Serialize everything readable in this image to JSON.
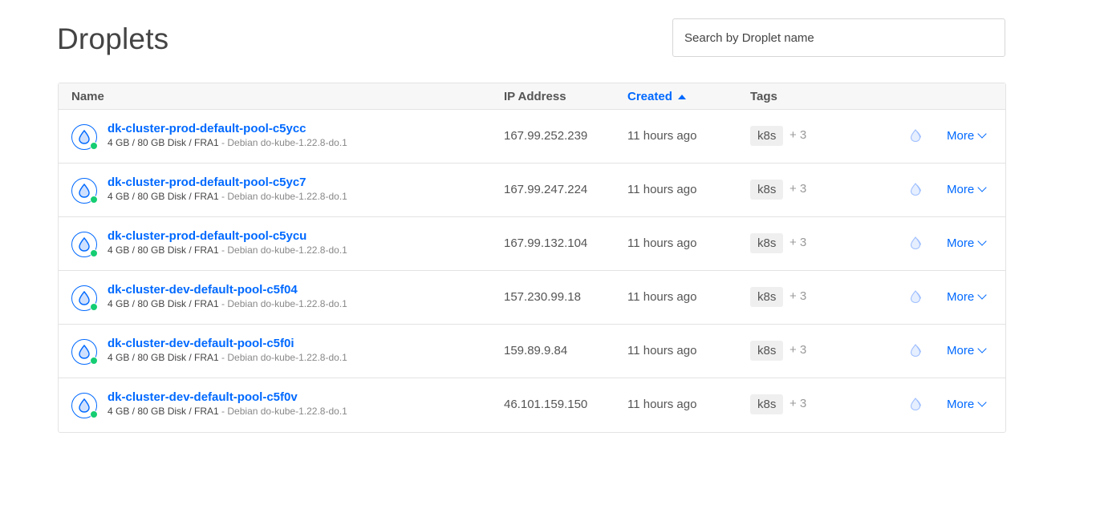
{
  "page": {
    "title": "Droplets"
  },
  "search": {
    "placeholder": "Search by Droplet name"
  },
  "table": {
    "headers": {
      "name": "Name",
      "ip": "IP Address",
      "created": "Created",
      "tags": "Tags"
    },
    "rows": [
      {
        "name": "dk-cluster-prod-default-pool-c5ycc",
        "specs": "4 GB / 80 GB Disk / FRA1",
        "image": " - Debian do-kube-1.22.8-do.1",
        "ip": "167.99.252.239",
        "created": "11 hours ago",
        "tag": "k8s",
        "tag_more": "+ 3",
        "more": "More"
      },
      {
        "name": "dk-cluster-prod-default-pool-c5yc7",
        "specs": "4 GB / 80 GB Disk / FRA1",
        "image": " - Debian do-kube-1.22.8-do.1",
        "ip": "167.99.247.224",
        "created": "11 hours ago",
        "tag": "k8s",
        "tag_more": "+ 3",
        "more": "More"
      },
      {
        "name": "dk-cluster-prod-default-pool-c5ycu",
        "specs": "4 GB / 80 GB Disk / FRA1",
        "image": " - Debian do-kube-1.22.8-do.1",
        "ip": "167.99.132.104",
        "created": "11 hours ago",
        "tag": "k8s",
        "tag_more": "+ 3",
        "more": "More"
      },
      {
        "name": "dk-cluster-dev-default-pool-c5f04",
        "specs": "4 GB / 80 GB Disk / FRA1",
        "image": " - Debian do-kube-1.22.8-do.1",
        "ip": "157.230.99.18",
        "created": "11 hours ago",
        "tag": "k8s",
        "tag_more": "+ 3",
        "more": "More"
      },
      {
        "name": "dk-cluster-dev-default-pool-c5f0i",
        "specs": "4 GB / 80 GB Disk / FRA1",
        "image": " - Debian do-kube-1.22.8-do.1",
        "ip": "159.89.9.84",
        "created": "11 hours ago",
        "tag": "k8s",
        "tag_more": "+ 3",
        "more": "More"
      },
      {
        "name": "dk-cluster-dev-default-pool-c5f0v",
        "specs": "4 GB / 80 GB Disk / FRA1",
        "image": " - Debian do-kube-1.22.8-do.1",
        "ip": "46.101.159.150",
        "created": "11 hours ago",
        "tag": "k8s",
        "tag_more": "+ 3",
        "more": "More"
      }
    ]
  },
  "icons": {
    "droplet": "droplet-icon",
    "status": "status-online-dot",
    "console": "console-icon",
    "more": "chevron-down-icon",
    "sort": "sort-ascending-icon"
  },
  "colors": {
    "accent": "#0069ff",
    "status_online": "#15cd72"
  }
}
